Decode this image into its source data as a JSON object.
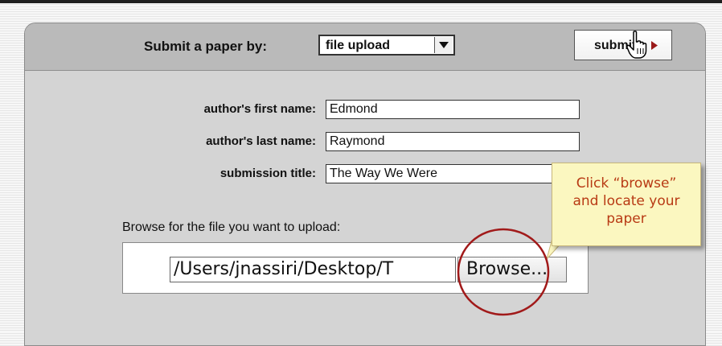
{
  "header": {
    "label": "Submit a paper by:",
    "method_select_value": "file upload",
    "submit_label": "submit"
  },
  "form": {
    "first_name_label": "author's first name:",
    "first_name_value": "Edmond",
    "last_name_label": "author's last name:",
    "last_name_value": "Raymond",
    "title_label": "submission title:",
    "title_value": "The Way We Were"
  },
  "file": {
    "browse_label": "Browse for the file you want to upload:",
    "path_value": "/Users/jnassiri/Desktop/T",
    "browse_button": "Browse..."
  },
  "callout": {
    "lines": [
      "Click “browse”",
      "and locate your",
      "paper"
    ]
  },
  "colors": {
    "callout_text": "#b83a14",
    "callout_bg": "#fbf7c0",
    "highlight_circle": "#a11a1a",
    "submit_arrow": "#9a1a1a"
  },
  "icons": [
    "dropdown-arrow-icon",
    "submit-arrow-icon",
    "hand-pointer-icon"
  ]
}
